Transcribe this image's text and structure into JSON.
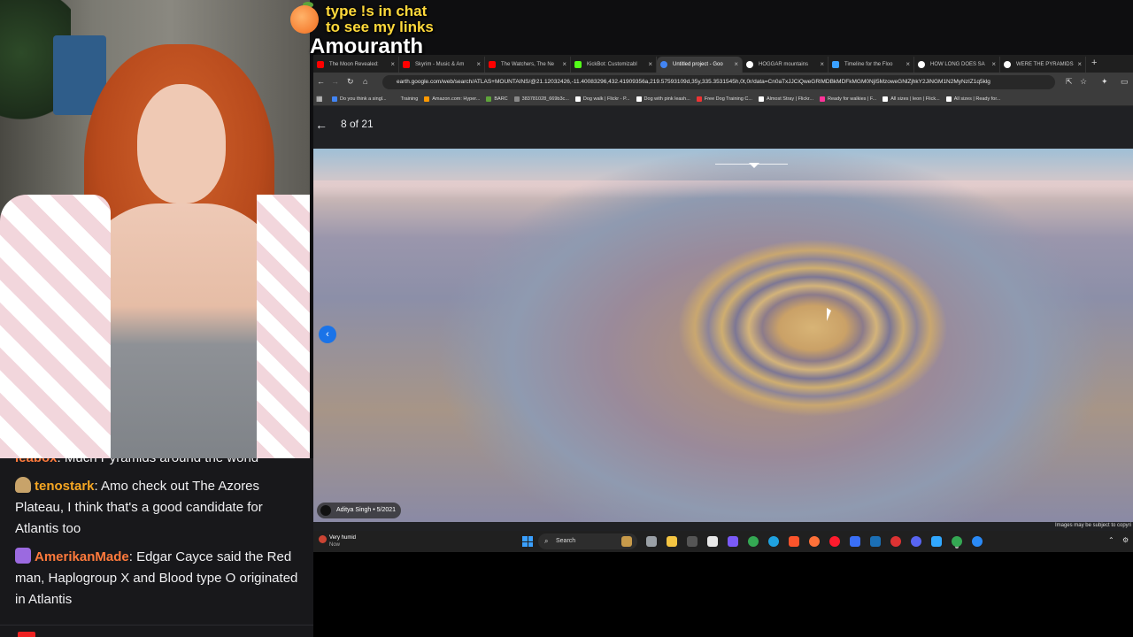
{
  "overlay": {
    "promo_line1": "type !s in chat",
    "promo_line2": "to see my links",
    "channel_name": "Amouranth"
  },
  "chat": {
    "cut_message": {
      "user": "leabox",
      "text": "Much Pyramids around the world"
    },
    "messages": [
      {
        "user": "tenostark",
        "user_color": "#f5a623",
        "badge_color": "#c8a36a",
        "text": "Amo check out The Azores Plateau, I think that's a good candidate for Atlantis too"
      },
      {
        "user": "AmerikanMade",
        "user_color": "#ff7a3c",
        "badge_color": "#9b6ae0",
        "text": "Edgar Cayce said the Red man, Haplogroup X and Blood type O originated in Atlantis"
      }
    ]
  },
  "browser": {
    "tabs": [
      {
        "label": "The Moon Revealed: ",
        "icon": "youtube-icon",
        "color": "#ff0000",
        "active": false
      },
      {
        "label": "Skyrim - Music & Am",
        "icon": "youtube-icon",
        "color": "#ff0000",
        "active": false
      },
      {
        "label": "The Watchers, The Ne",
        "icon": "youtube-icon",
        "color": "#ff0000",
        "active": false
      },
      {
        "label": "KickBot: Customizabl",
        "icon": "kick-icon",
        "color": "#53fc18",
        "active": false
      },
      {
        "label": "Untitled project - Goo",
        "icon": "earth-icon",
        "color": "#4285f4",
        "active": true
      },
      {
        "label": "HOGGAR mountains",
        "icon": "google-icon",
        "color": "#ffffff",
        "active": false
      },
      {
        "label": "Timeline for the Floo",
        "icon": "doc-icon",
        "color": "#3aa0ff",
        "active": false
      },
      {
        "label": "HOW LONG DOES SA",
        "icon": "google-icon",
        "color": "#ffffff",
        "active": false
      },
      {
        "label": "WERE THE PYRAMIDS",
        "icon": "google-icon",
        "color": "#ffffff",
        "active": false
      }
    ],
    "url": "earth.google.com/web/search/ATLAS+MOUNTAINS/@21.12032426,-11.40083296,432.41909356a,219.57593109d,35y,335.3531545h,0t,0r/data=Cn0aTxJJCiQweGRlMDBkMDFkMGM0NjI5MzoweGNlZjhkY2JiNGM1N2MyNzIZ1q5klg",
    "bookmarks": [
      "Do you think a singl...",
      "Training",
      "Amazon.com: Hyper...",
      "BARC",
      "383781028_669b3c...",
      "Dog walk | Flickr - P...",
      "Dog with pink leash...",
      "Free Dog Training C...",
      "Almost Stray | Flickr...",
      "Ready for walkies | F...",
      "All sizes | leon | Flick...",
      "All sizes | Ready for..."
    ]
  },
  "earth": {
    "counter": "8 of 21",
    "credit": "Aditya Singh • 5/2021",
    "notice": "Images may be subject to copyri"
  },
  "taskbar": {
    "weather_line1": "Very humid",
    "weather_line2": "Now",
    "search_label": "Search",
    "icons": [
      {
        "name": "task-view-icon",
        "color": "#9aa0a6"
      },
      {
        "name": "file-explorer-icon",
        "color": "#f4c542"
      },
      {
        "name": "terminal-icon",
        "color": "#555555"
      },
      {
        "name": "calendar-icon",
        "color": "#e8e8e8"
      },
      {
        "name": "copilot-icon",
        "color": "#7a5af8"
      },
      {
        "name": "chrome-icon",
        "color": "#34a853"
      },
      {
        "name": "edge-icon",
        "color": "#1fa2e0"
      },
      {
        "name": "brave-icon",
        "color": "#fb542b"
      },
      {
        "name": "firefox-icon",
        "color": "#ff7139"
      },
      {
        "name": "opera-icon",
        "color": "#ff1b2d"
      },
      {
        "name": "app-r-icon",
        "color": "#3a6ff7"
      },
      {
        "name": "steam-icon",
        "color": "#1b6fb5"
      },
      {
        "name": "record-icon",
        "color": "#d33"
      },
      {
        "name": "discord-icon",
        "color": "#5865f2"
      },
      {
        "name": "photoshop-icon",
        "color": "#31a8ff"
      },
      {
        "name": "chrome-active-icon",
        "color": "#34a853"
      },
      {
        "name": "app-blue-icon",
        "color": "#2a8af6"
      }
    ]
  }
}
